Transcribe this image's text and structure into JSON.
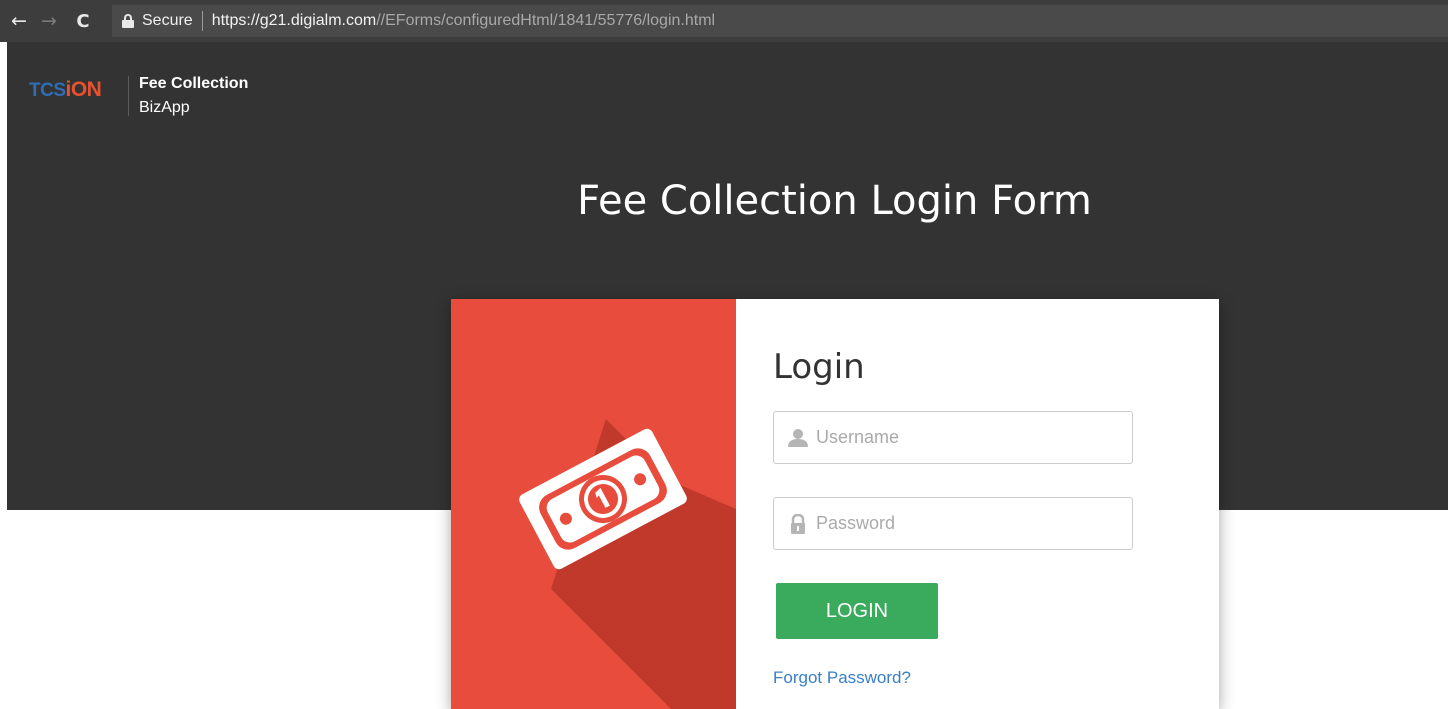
{
  "browser": {
    "back_icon": "arrow-left-icon",
    "forward_icon": "arrow-right-icon",
    "reload_icon": "reload-icon",
    "secure_label": "Secure",
    "url_host": "https://g21.digialm.com",
    "url_path": "//EForms/configuredHtml/1841/55776/login.html"
  },
  "header": {
    "logo_tcs": "TCS",
    "logo_ion": "iON",
    "app_title": "Fee Collection",
    "app_subtitle": "BizApp",
    "page_title": "Fee Collection Login Form"
  },
  "login": {
    "heading": "Login",
    "username_placeholder": "Username",
    "password_placeholder": "Password",
    "login_button": "LOGIN",
    "forgot_password": "Forgot Password?",
    "banknote_icon": "banknote-icon",
    "user_icon": "user-icon",
    "lock_icon": "lock-icon"
  },
  "colors": {
    "header_bg": "#333333",
    "card_accent": "#e74c3c",
    "button_green": "#3aaa5c",
    "link_blue": "#3a7fc6",
    "logo_blue": "#2f6db5",
    "logo_orange": "#e8512e"
  }
}
